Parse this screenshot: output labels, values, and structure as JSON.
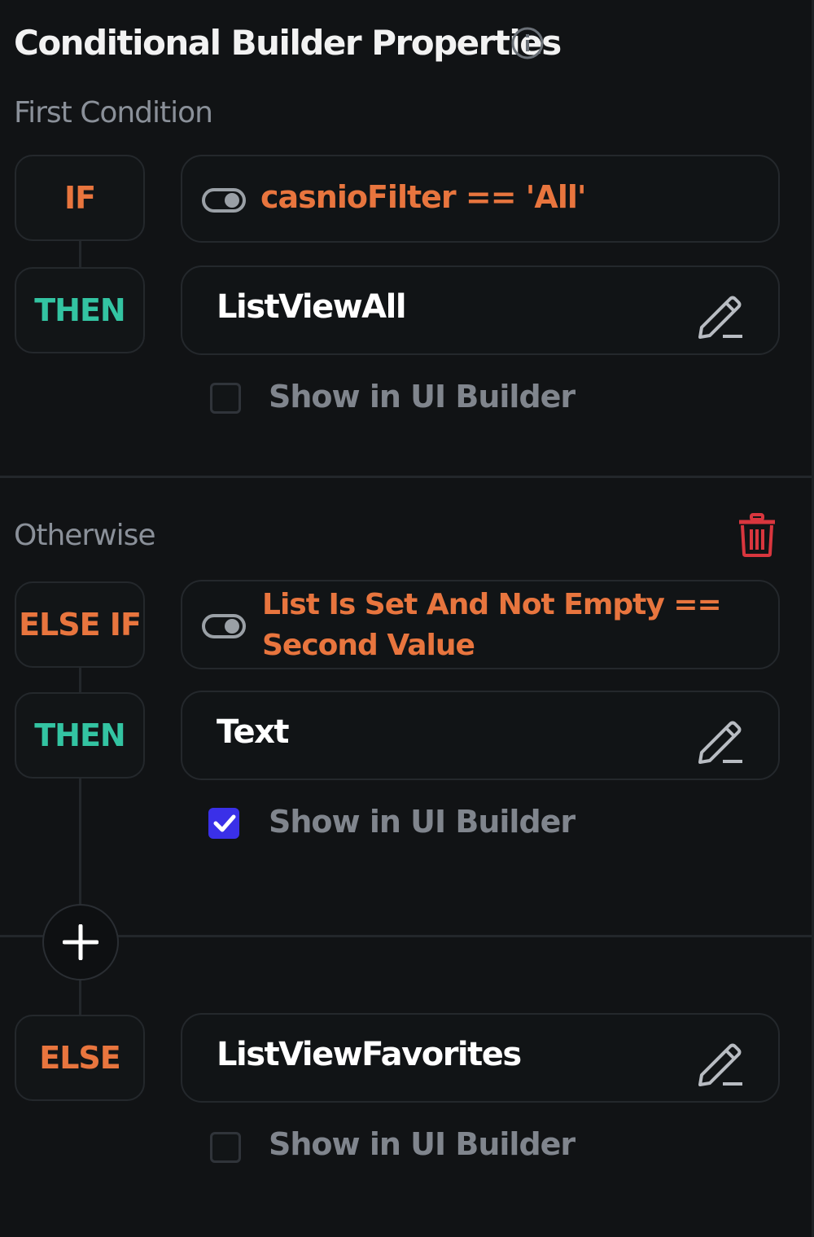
{
  "panel": {
    "title": "Conditional Builder Properties",
    "info_icon": "info-circle-icon"
  },
  "first_condition": {
    "label": "First Condition",
    "if_keyword": "IF",
    "condition_text": "casnioFilter  ==  'All'",
    "then_keyword": "THEN",
    "widget": "ListViewAll",
    "show_in_ui_builder": {
      "label": "Show in UI Builder",
      "checked": false
    }
  },
  "otherwise": {
    "label": "Otherwise",
    "delete_icon": "trash-icon",
    "elseif_keyword": "ELSE IF",
    "condition_line1": "List Is Set And Not Empty  ==",
    "condition_line2": "Second Value",
    "then_keyword": "THEN",
    "widget": "Text",
    "show_in_ui_builder": {
      "label": "Show in UI Builder",
      "checked": true
    }
  },
  "else_block": {
    "else_keyword": "ELSE",
    "widget": "ListViewFavorites",
    "show_in_ui_builder": {
      "label": "Show in UI Builder",
      "checked": false
    }
  },
  "colors": {
    "background": "#111315",
    "keyword_orange": "#e8753e",
    "keyword_teal": "#33c4a2",
    "checkbox_checked": "#3a30e8",
    "delete_red": "#d9363e"
  }
}
